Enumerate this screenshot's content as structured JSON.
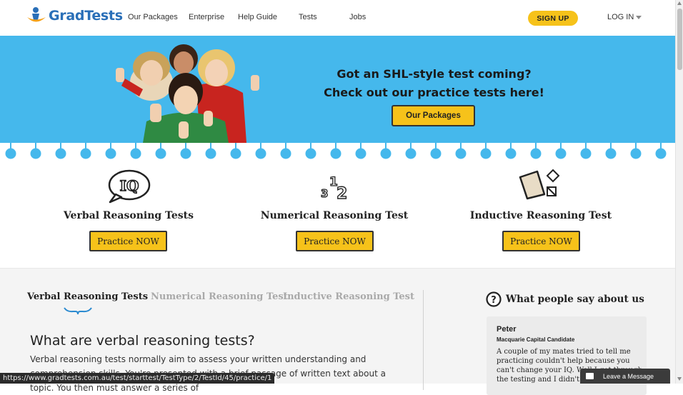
{
  "brand": {
    "name": "GradTests"
  },
  "nav": {
    "items": [
      "Our Packages",
      "Enterprise",
      "Help Guide",
      "Tests",
      "Jobs"
    ],
    "signup": "SIGN UP",
    "login": "LOG IN"
  },
  "hero": {
    "line1": "Got an SHL-style test coming?",
    "line2": "Check out our practice tests here!",
    "button": "Our Packages"
  },
  "categories": [
    {
      "title": "Verbal Reasoning Tests",
      "button": "Practice NOW",
      "icon": "iq-speech-bubble-icon"
    },
    {
      "title": "Numerical Reasoning Test",
      "button": "Practice NOW",
      "icon": "numbers-icon"
    },
    {
      "title": "Inductive Reasoning Test",
      "button": "Practice NOW",
      "icon": "shapes-icon"
    }
  ],
  "tabs": {
    "active": "Verbal Reasoning Tests",
    "numerical": "Numerical Reasoning Test",
    "inductive": "Inductive Reasoning Test"
  },
  "section": {
    "title": "What are verbal reasoning tests?",
    "body": "Verbal reasoning tests normally aim to assess your written understanding and comprehension skills. You're presented with a brief passage of written text about a topic. You then must answer a series of"
  },
  "testimonials": {
    "title": "What people say about us",
    "name": "Peter",
    "role": "Macquarie Capital Candidate",
    "text": "A couple of my mates tried to tell me practicing couldn't help because you can't change your IQ. Well I got through the testing and I didn't. So..."
  },
  "status_url": "https://www.gradtests.com.au/test/starttest/TestType/2/TestId/45/practice/1",
  "chat": {
    "label": "Leave a Message"
  },
  "colors": {
    "accent": "#f6c21a",
    "hero": "#45b8ec",
    "brand": "#2a6fb8"
  }
}
